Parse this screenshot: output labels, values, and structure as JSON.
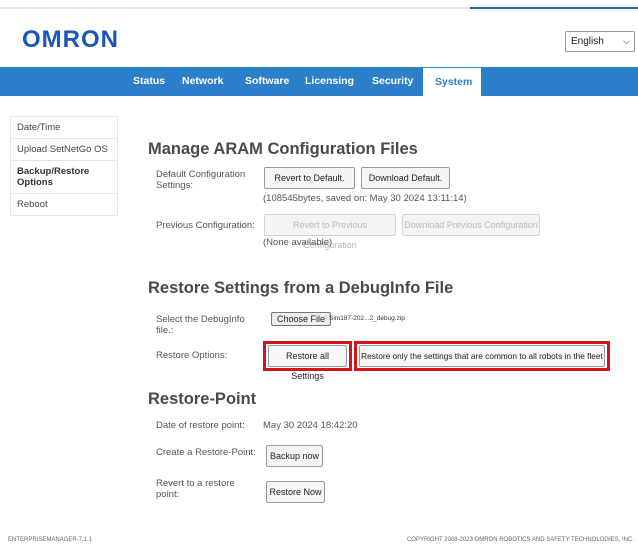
{
  "brand": {
    "logo_text": "omron"
  },
  "language": {
    "selected": "English"
  },
  "nav": {
    "items": [
      "Status",
      "Network",
      "Software",
      "Licensing",
      "Security",
      "System"
    ],
    "active": "System"
  },
  "sidebar": {
    "items": [
      "Date/Time",
      "Upload SetNetGo OS",
      "Backup/Restore Options",
      "Reboot"
    ],
    "active_index": 2
  },
  "aram": {
    "heading": "Manage ARAM Configuration Files",
    "default_label": "Default Configuration Settings:",
    "revert_default_button": "Revert to Default.",
    "download_default_button": "Download Default.",
    "default_note": "(108545bytes, saved on: May 30 2024 13:11:14)",
    "previous_label": "Previous Configuration:",
    "revert_previous_button": "Revert to Previous Configuration",
    "download_previous_button": "Download Previous Configuration",
    "previous_note": "(None available)"
  },
  "debuginfo": {
    "heading": "Restore Settings from a DebugInfo File",
    "select_label": "Select the DebugInfo file.:",
    "choose_file_button": "Choose File",
    "file_name": "Sim187-202...2_debug.zip",
    "options_label": "Restore Options:",
    "restore_all_button": "Restore all Settings",
    "restore_common_button": "Restore only the settings that are common to all robots in the fleet",
    "highlight_color": "#d0161c"
  },
  "restore_point": {
    "heading": "Restore-Point",
    "date_label": "Date of restore point:",
    "date_value": "May 30 2024 18:42:20",
    "create_label": "Create a Restore-Point:",
    "backup_button": "Backup now",
    "revert_label": "Revert to a restore point:",
    "restore_button": "Restore Now"
  },
  "footer": {
    "version": "ENTERPRISEMANAGER-7.1.1",
    "copyright": "COPYRIGHT 2008-2023 OMRON ROBOTICS AND SAFETY TECHNOLOGIES, INC."
  }
}
